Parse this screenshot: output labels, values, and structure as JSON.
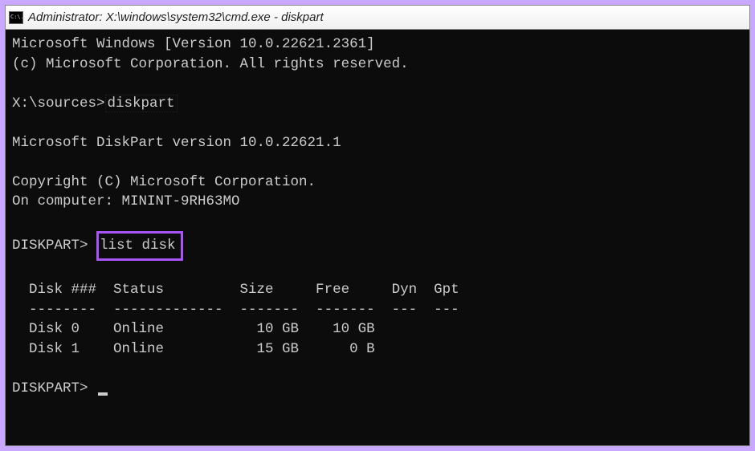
{
  "window": {
    "title": "Administrator: X:\\windows\\system32\\cmd.exe - diskpart",
    "icon_label": "C:\\."
  },
  "terminal": {
    "header_version": "Microsoft Windows [Version 10.0.22621.2361]",
    "header_copyright": "(c) Microsoft Corporation. All rights reserved.",
    "prompt1_path": "X:\\sources>",
    "prompt1_cmd": "diskpart",
    "diskpart_version": "Microsoft DiskPart version 10.0.22621.1",
    "diskpart_copyright": "Copyright (C) Microsoft Corporation.",
    "diskpart_computer": "On computer: MININT-9RH63MO",
    "prompt2_label": "DISKPART>",
    "prompt2_cmd": "list disk",
    "table": {
      "header": "  Disk ###  Status         Size     Free     Dyn  Gpt",
      "divider": "  --------  -------------  -------  -------  ---  ---",
      "rows": [
        "  Disk 0    Online           10 GB    10 GB        ",
        "  Disk 1    Online           15 GB      0 B         "
      ]
    },
    "prompt3_label": "DISKPART>"
  }
}
